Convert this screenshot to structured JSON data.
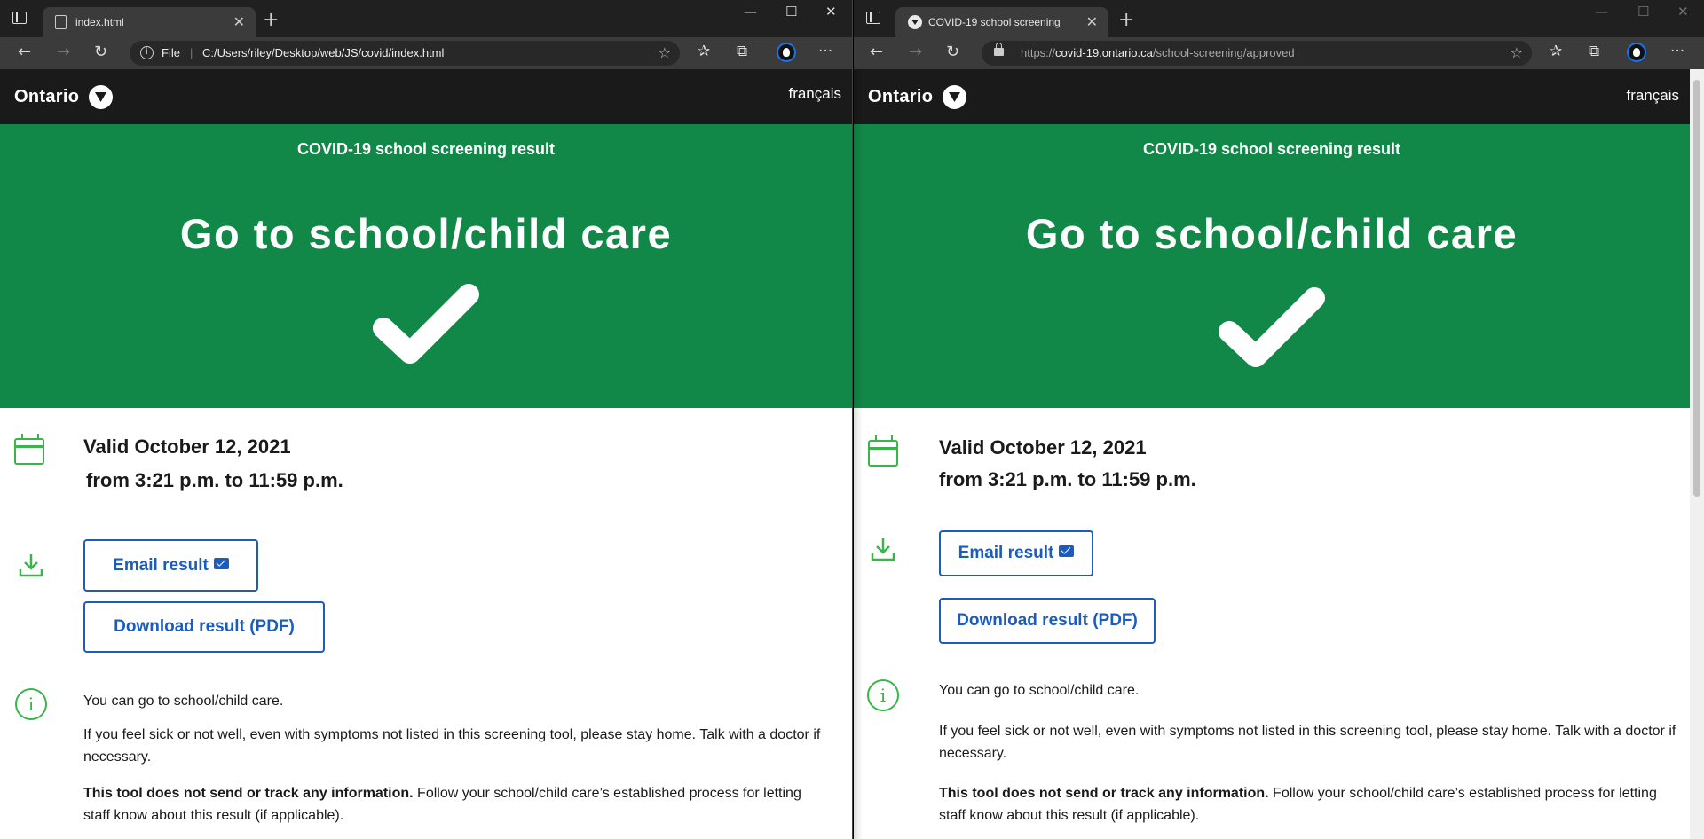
{
  "left": {
    "tab_title": "index.html",
    "address_label": "File",
    "url": "C:/Users/riley/Desktop/web/JS/covid/index.html"
  },
  "right": {
    "tab_title": "COVID-19 school screening",
    "url_prefix": "https://",
    "url_host": "covid-19.ontario.ca",
    "url_path": "/school-screening/approved"
  },
  "page": {
    "logo_text": "Ontario",
    "lang_link": "français",
    "banner_sub": "COVID-19 school screening result",
    "banner_title": "Go to school/child care",
    "valid_line1": "Valid October 12, 2021",
    "valid_line2": "from 3:21 p.m. to 11:59 p.m.",
    "email_button": "Email result",
    "download_button": "Download result (PDF)",
    "info_line": "You can go to school/child care.",
    "sick_text": "If you feel sick or not well, even with symptoms not listed in this screening tool, please stay home. Talk with a doctor if necessary.",
    "tool_bold": "This tool does not send or track any information.",
    "tool_rest": " Follow your school/child care’s established process for letting staff know about this result (if applicable)."
  },
  "colors": {
    "banner_green": "#118847",
    "icon_green": "#39b54a",
    "button_blue": "#1a5cc0",
    "header_black": "#1a1a1a"
  },
  "icons": [
    "sidebar-icon",
    "page-icon",
    "close-icon",
    "plus-icon",
    "minimize-icon",
    "maximize-icon",
    "window-close-icon",
    "back-icon",
    "forward-icon",
    "refresh-icon",
    "info-icon",
    "lock-icon",
    "favorite-add-icon",
    "favorites-icon",
    "collections-icon",
    "profile-icon",
    "more-icon",
    "trillium-logo-icon",
    "checkmark-icon",
    "calendar-icon",
    "download-icon",
    "mail-icon"
  ]
}
